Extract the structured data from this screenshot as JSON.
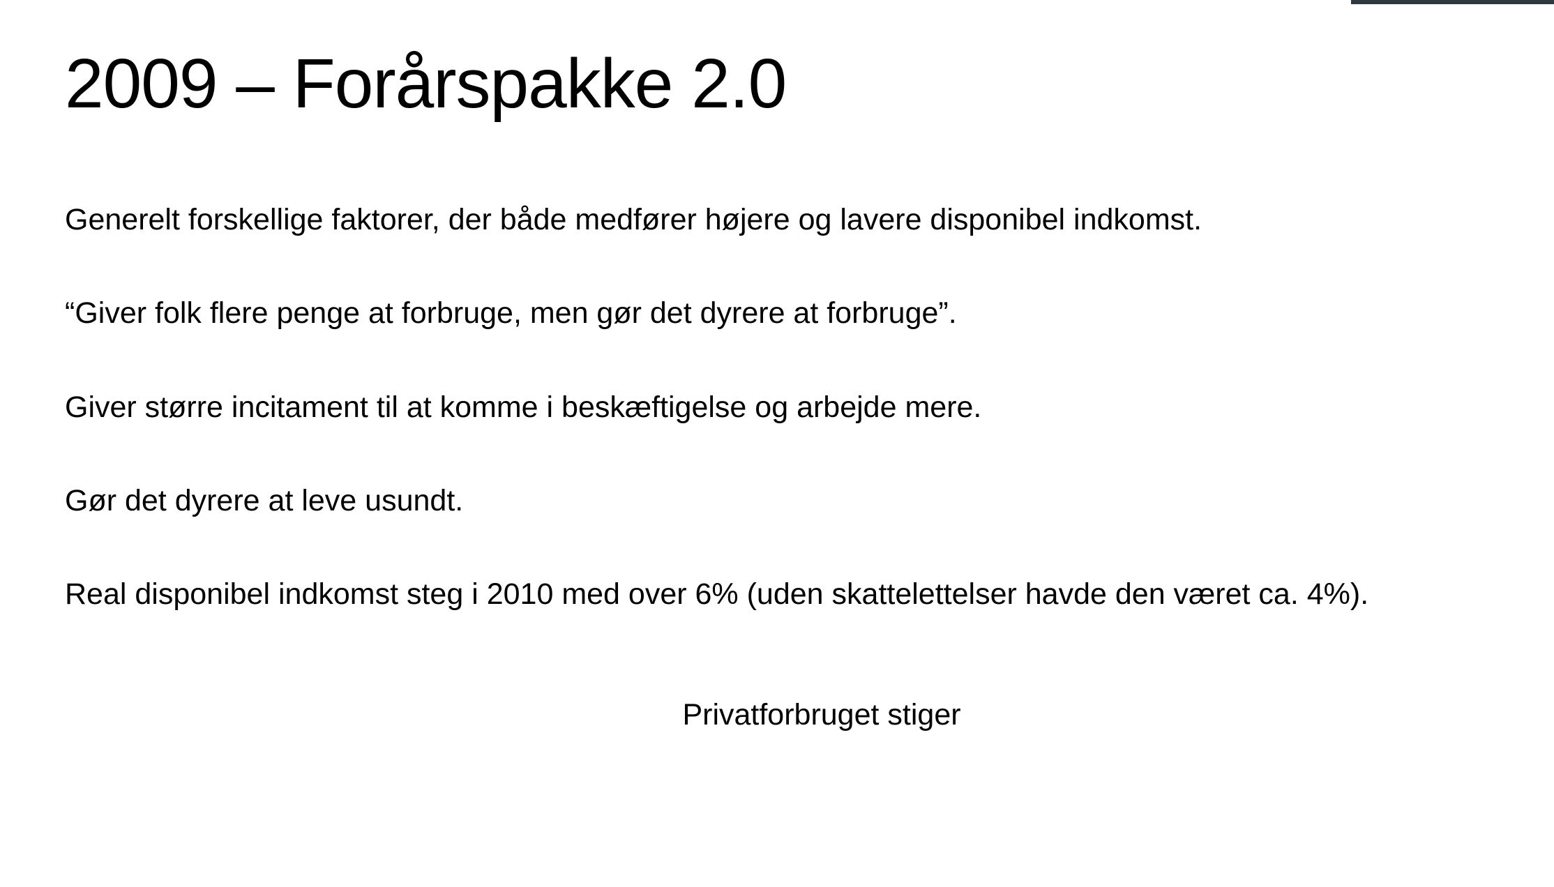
{
  "slide": {
    "title": "2009 – Forårspakke 2.0",
    "paragraphs": [
      "Generelt forskellige faktorer, der både medfører højere og lavere disponibel indkomst.",
      "“Giver folk flere penge at forbruge, men gør det dyrere at forbruge”.",
      "Giver større incitament til at komme i beskæftigelse og arbejde mere.",
      "Gør det dyrere at leve usundt.",
      "Real disponibel indkomst steg i 2010 med over 6% (uden skattelettelser havde den været ca. 4%)."
    ],
    "conclusion": "Privatforbruget stiger"
  }
}
